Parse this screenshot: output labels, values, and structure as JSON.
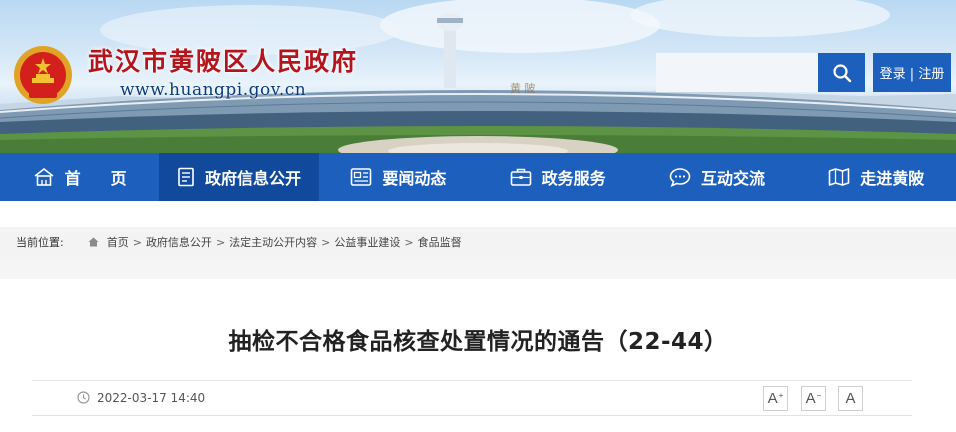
{
  "header": {
    "site_title": "武汉市黄陂区人民政府",
    "site_url": "www.huangpi.gov.cn",
    "search": {
      "value": "",
      "placeholder": ""
    },
    "login_label": "登录 | 注册"
  },
  "nav": {
    "items": [
      {
        "label": "首页",
        "icon": "home-icon"
      },
      {
        "label": "政府信息公开",
        "icon": "document-icon",
        "active": true
      },
      {
        "label": "要闻动态",
        "icon": "news-icon"
      },
      {
        "label": "政务服务",
        "icon": "briefcase-icon"
      },
      {
        "label": "互动交流",
        "icon": "chat-icon"
      },
      {
        "label": "走进黄陂",
        "icon": "map-icon"
      }
    ]
  },
  "breadcrumb": {
    "label": "当前位置:",
    "items": [
      "首页",
      "政府信息公开",
      "法定主动公开内容",
      "公益事业建设",
      "食品监督"
    ],
    "separator": ">"
  },
  "article": {
    "title": "抽检不合格食品核查处置情况的通告（22-44）",
    "date": "2022-03-17 14:40",
    "font_controls": [
      "A",
      "A",
      "A"
    ]
  },
  "colors": {
    "nav_bg": "#1d5fbd",
    "nav_active": "#114a9c",
    "site_title": "#b4141c",
    "site_url": "#0e3c7a"
  }
}
